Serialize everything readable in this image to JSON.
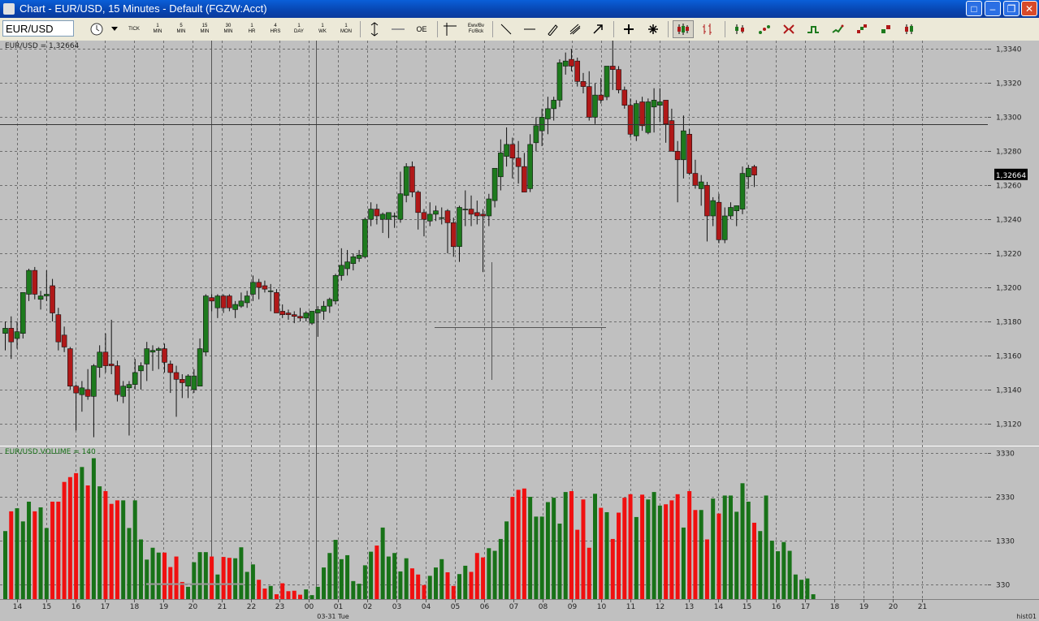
{
  "window": {
    "title": "Chart - EUR/USD,  15 Minutes - Default (FGZW:Acct)",
    "controls": [
      "restore-icon",
      "minimize-icon",
      "maximize-icon",
      "close-icon"
    ]
  },
  "toolbar": {
    "symbol": "EUR/USD",
    "interval_buttons": [
      {
        "top": "",
        "bottom": "TICK"
      },
      {
        "top": "1",
        "bottom": "MIN"
      },
      {
        "top": "5",
        "bottom": "MIN"
      },
      {
        "top": "15",
        "bottom": "MIN"
      },
      {
        "top": "30",
        "bottom": "MIN"
      },
      {
        "top": "1",
        "bottom": "HR"
      },
      {
        "top": "4",
        "bottom": "HRS"
      },
      {
        "top": "1",
        "bottom": "DAY"
      },
      {
        "top": "1",
        "bottom": "WK"
      },
      {
        "top": "1",
        "bottom": "MON"
      }
    ],
    "oe_label": "OE",
    "text_tool": {
      "top": "Ewv/Bv",
      "bottom": "Fc/Bck"
    },
    "icons": [
      "clock-icon",
      "dropdown-icon",
      "autoscale-icon",
      "flat-line-icon",
      "crosshair-icon",
      "line-icon",
      "horizontal-line-icon",
      "pencil-icon",
      "fork-icon",
      "arrow-icon",
      "plus-icon",
      "star-icon",
      "candlestick-icon",
      "bar-chart-icon",
      "ohlc-icon",
      "dots-icon",
      "point-figure-icon",
      "step-line-icon",
      "tick-line-icon",
      "renko-icon",
      "kagi-icon",
      "range-icon"
    ]
  },
  "chart_data": [
    {
      "type": "candlestick",
      "label": "EUR/USD = 1,32664",
      "last_price_tag": "1,32664",
      "ylim": [
        1.3108,
        1.3345
      ],
      "yticks": [
        "1,3120",
        "1,3140",
        "1,3160",
        "1,3180",
        "1,3200",
        "1,3220",
        "1,3240",
        "1,3260",
        "1,3280",
        "1,3300",
        "1,3320",
        "1,3340"
      ],
      "ytick_values": [
        1.312,
        1.314,
        1.316,
        1.318,
        1.32,
        1.322,
        1.324,
        1.326,
        1.328,
        1.33,
        1.332,
        1.334
      ],
      "x_labels": [
        "14",
        "15",
        "16",
        "17",
        "18",
        "19",
        "20",
        "21",
        "22",
        "23",
        "00",
        "01",
        "02",
        "03",
        "04",
        "05",
        "06",
        "07",
        "08",
        "09",
        "10",
        "11",
        "12",
        "13",
        "14",
        "15",
        "16",
        "17",
        "18",
        "19",
        "20",
        "21"
      ],
      "date_label": "03-31 Tue",
      "crosshair_price": 1.3296,
      "grid": true,
      "bull_color": "#1d7a1d",
      "bear_color": "#b01818",
      "candles": [
        [
          1.3173,
          1.318,
          1.3163,
          1.3176
        ],
        [
          1.3176,
          1.3183,
          1.3158,
          1.3168
        ],
        [
          1.317,
          1.318,
          1.3164,
          1.3174
        ],
        [
          1.3173,
          1.3197,
          1.317,
          1.3197
        ],
        [
          1.3196,
          1.3211,
          1.3192,
          1.321
        ],
        [
          1.321,
          1.3212,
          1.3193,
          1.3196
        ],
        [
          1.3193,
          1.3198,
          1.3187,
          1.3195
        ],
        [
          1.3195,
          1.321,
          1.3192,
          1.3196
        ],
        [
          1.3201,
          1.3205,
          1.318,
          1.3185
        ],
        [
          1.3184,
          1.3188,
          1.3163,
          1.3168
        ],
        [
          1.3172,
          1.3177,
          1.3162,
          1.3165
        ],
        [
          1.3164,
          1.3165,
          1.314,
          1.3142
        ],
        [
          1.3142,
          1.3143,
          1.3116,
          1.3138
        ],
        [
          1.3137,
          1.3145,
          1.3127,
          1.3141
        ],
        [
          1.314,
          1.3152,
          1.3134,
          1.3136
        ],
        [
          1.3136,
          1.3155,
          1.3112,
          1.3154
        ],
        [
          1.3153,
          1.3166,
          1.3147,
          1.3162
        ],
        [
          1.3162,
          1.3173,
          1.315,
          1.3154
        ],
        [
          1.3155,
          1.3181,
          1.3149,
          1.3154
        ],
        [
          1.3154,
          1.3157,
          1.3133,
          1.3137
        ],
        [
          1.3136,
          1.3145,
          1.3132,
          1.3142
        ],
        [
          1.3141,
          1.3145,
          1.3113,
          1.3143
        ],
        [
          1.3143,
          1.3158,
          1.314,
          1.315
        ],
        [
          1.3151,
          1.3156,
          1.314,
          1.3154
        ],
        [
          1.3155,
          1.3168,
          1.3145,
          1.3164
        ],
        [
          1.3162,
          1.3166,
          1.3151,
          1.3163
        ],
        [
          1.3163,
          1.3165,
          1.3152,
          1.3164
        ],
        [
          1.3164,
          1.3167,
          1.315,
          1.3156
        ],
        [
          1.3155,
          1.3157,
          1.3138,
          1.315
        ],
        [
          1.315,
          1.3154,
          1.3124,
          1.3146
        ],
        [
          1.3146,
          1.3149,
          1.3135,
          1.3144
        ],
        [
          1.3142,
          1.3149,
          1.3135,
          1.3148
        ],
        [
          1.314,
          1.3152,
          1.3138,
          1.3148
        ],
        [
          1.3142,
          1.317,
          1.3142,
          1.3164
        ],
        [
          1.3162,
          1.3196,
          1.316,
          1.3195
        ],
        [
          1.3194,
          1.3196,
          1.3186,
          1.3192
        ],
        [
          1.3188,
          1.3196,
          1.3182,
          1.3195
        ],
        [
          1.3195,
          1.3196,
          1.3185,
          1.3188
        ],
        [
          1.3195,
          1.3196,
          1.3186,
          1.3188
        ],
        [
          1.3187,
          1.3192,
          1.3182,
          1.319
        ],
        [
          1.3189,
          1.3197,
          1.3188,
          1.3192
        ],
        [
          1.3191,
          1.3198,
          1.3188,
          1.3195
        ],
        [
          1.3196,
          1.3207,
          1.3192,
          1.3203
        ],
        [
          1.3203,
          1.3205,
          1.3193,
          1.32
        ],
        [
          1.3201,
          1.3204,
          1.3197,
          1.3199
        ],
        [
          1.3198,
          1.3202,
          1.3186,
          1.3198
        ],
        [
          1.3197,
          1.3199,
          1.3186,
          1.3185
        ],
        [
          1.3186,
          1.319,
          1.3182,
          1.3184
        ],
        [
          1.3185,
          1.3187,
          1.3181,
          1.3184
        ],
        [
          1.3184,
          1.3186,
          1.3179,
          1.3183
        ],
        [
          1.3183,
          1.3188,
          1.318,
          1.3182
        ],
        [
          1.3182,
          1.3186,
          1.318,
          1.3185
        ],
        [
          1.3179,
          1.3186,
          1.3178,
          1.3186
        ],
        [
          1.3185,
          1.3189,
          1.3171,
          1.3187
        ],
        [
          1.3186,
          1.3192,
          1.3181,
          1.3189
        ],
        [
          1.3189,
          1.3194,
          1.3185,
          1.3193
        ],
        [
          1.3192,
          1.3208,
          1.319,
          1.3207
        ],
        [
          1.3207,
          1.3223,
          1.3204,
          1.3213
        ],
        [
          1.3211,
          1.3222,
          1.3207,
          1.3215
        ],
        [
          1.3214,
          1.322,
          1.321,
          1.3218
        ],
        [
          1.3217,
          1.3222,
          1.3215,
          1.3219
        ],
        [
          1.3218,
          1.3241,
          1.3217,
          1.324
        ],
        [
          1.324,
          1.325,
          1.3236,
          1.3246
        ],
        [
          1.3246,
          1.3249,
          1.3237,
          1.3242
        ],
        [
          1.324,
          1.3244,
          1.3232,
          1.3243
        ],
        [
          1.324,
          1.3243,
          1.3229,
          1.3244
        ],
        [
          1.3242,
          1.3244,
          1.3235,
          1.3242
        ],
        [
          1.324,
          1.3268,
          1.3238,
          1.3255
        ],
        [
          1.3254,
          1.3273,
          1.325,
          1.3271
        ],
        [
          1.3271,
          1.3274,
          1.3253,
          1.3256
        ],
        [
          1.3256,
          1.3257,
          1.3234,
          1.3244
        ],
        [
          1.3244,
          1.3246,
          1.323,
          1.324
        ],
        [
          1.3239,
          1.325,
          1.3236,
          1.3243
        ],
        [
          1.3243,
          1.3248,
          1.3239,
          1.3245
        ],
        [
          1.3241,
          1.3247,
          1.3237,
          1.3241
        ],
        [
          1.3245,
          1.3246,
          1.322,
          1.3238
        ],
        [
          1.3238,
          1.3241,
          1.3218,
          1.3224
        ],
        [
          1.3224,
          1.3248,
          1.3215,
          1.3247
        ],
        [
          1.3246,
          1.3257,
          1.3236,
          1.3246
        ],
        [
          1.3246,
          1.3254,
          1.3236,
          1.3243
        ],
        [
          1.3244,
          1.3251,
          1.3237,
          1.3242
        ],
        [
          1.3243,
          1.3246,
          1.3209,
          1.3242
        ],
        [
          1.3242,
          1.3255,
          1.3236,
          1.3252
        ],
        [
          1.3251,
          1.3269,
          1.3247,
          1.327
        ],
        [
          1.3265,
          1.3287,
          1.3257,
          1.3279
        ],
        [
          1.3277,
          1.3294,
          1.3271,
          1.3284
        ],
        [
          1.3284,
          1.3288,
          1.3264,
          1.3276
        ],
        [
          1.3276,
          1.3286,
          1.3261,
          1.3271
        ],
        [
          1.3271,
          1.3279,
          1.3256,
          1.3256
        ],
        [
          1.3258,
          1.329,
          1.3256,
          1.3284
        ],
        [
          1.3285,
          1.33,
          1.328,
          1.3295
        ],
        [
          1.3292,
          1.3305,
          1.3283,
          1.33
        ],
        [
          1.3299,
          1.3312,
          1.329,
          1.3305
        ],
        [
          1.3305,
          1.3312,
          1.3298,
          1.331
        ],
        [
          1.331,
          1.3334,
          1.3306,
          1.3332
        ],
        [
          1.333,
          1.3338,
          1.3325,
          1.3333
        ],
        [
          1.3334,
          1.334,
          1.3327,
          1.333
        ],
        [
          1.3333,
          1.3335,
          1.3318,
          1.3321
        ],
        [
          1.3321,
          1.3326,
          1.3314,
          1.3318
        ],
        [
          1.3318,
          1.3327,
          1.3298,
          1.33
        ],
        [
          1.33,
          1.332,
          1.3296,
          1.3313
        ],
        [
          1.3313,
          1.3323,
          1.3308,
          1.331
        ],
        [
          1.3312,
          1.333,
          1.331,
          1.333
        ],
        [
          1.333,
          1.3345,
          1.3316,
          1.3328
        ],
        [
          1.3328,
          1.333,
          1.3314,
          1.3316
        ],
        [
          1.3316,
          1.3318,
          1.3305,
          1.3307
        ],
        [
          1.3307,
          1.3311,
          1.3288,
          1.329
        ],
        [
          1.3289,
          1.331,
          1.3286,
          1.3308
        ],
        [
          1.3309,
          1.3312,
          1.3292,
          1.3295
        ],
        [
          1.3291,
          1.3311,
          1.329,
          1.3309
        ],
        [
          1.3306,
          1.3317,
          1.3291,
          1.331
        ],
        [
          1.3307,
          1.3317,
          1.3297,
          1.3309
        ],
        [
          1.331,
          1.331,
          1.3285,
          1.3296
        ],
        [
          1.3298,
          1.3305,
          1.328,
          1.328
        ],
        [
          1.328,
          1.3286,
          1.325,
          1.3275
        ],
        [
          1.3275,
          1.3301,
          1.3264,
          1.3292
        ],
        [
          1.329,
          1.3293,
          1.3266,
          1.3267
        ],
        [
          1.3267,
          1.3275,
          1.3258,
          1.326
        ],
        [
          1.3258,
          1.3266,
          1.3248,
          1.3262
        ],
        [
          1.326,
          1.3262,
          1.3227,
          1.3242
        ],
        [
          1.3242,
          1.3253,
          1.3236,
          1.3251
        ],
        [
          1.325,
          1.3255,
          1.3226,
          1.3228
        ],
        [
          1.3228,
          1.3247,
          1.3226,
          1.3242
        ],
        [
          1.3242,
          1.325,
          1.324,
          1.3247
        ],
        [
          1.3245,
          1.3248,
          1.3236,
          1.3248
        ],
        [
          1.3246,
          1.3271,
          1.3243,
          1.3267
        ],
        [
          1.3265,
          1.3272,
          1.3258,
          1.327
        ],
        [
          1.3271,
          1.3272,
          1.3259,
          1.3266
        ]
      ]
    },
    {
      "type": "bar",
      "label": "EUR/USD.VOLUME = 140",
      "ylim": [
        0,
        3330
      ],
      "yticks": [
        "330",
        "1330",
        "2330",
        "3330"
      ],
      "ytick_values": [
        330,
        1330,
        2330,
        3330
      ],
      "grid": true,
      "bull_color": "#187218",
      "bear_color": "#f01010",
      "values": [
        1550,
        2000,
        2070,
        1770,
        2220,
        2000,
        2090,
        1620,
        2220,
        2220,
        2670,
        2780,
        2870,
        3010,
        2590,
        3210,
        2570,
        2460,
        2170,
        2250,
        2250,
        1620,
        2250,
        1360,
        900,
        1170,
        1060,
        1060,
        730,
        970,
        390,
        280,
        840,
        1070,
        1070,
        970,
        560,
        960,
        940,
        930,
        1180,
        620,
        790,
        440,
        240,
        300,
        110,
        360,
        180,
        190,
        100,
        220,
        90,
        280,
        720,
        1050,
        1350,
        910,
        1000,
        410,
        350,
        770,
        1080,
        1220,
        1630,
        970,
        1050,
        630,
        930,
        700,
        560,
        320,
        530,
        720,
        910,
        610,
        300,
        570,
        760,
        620,
        1050,
        950,
        1160,
        1100,
        1370,
        1770,
        2330,
        2490,
        2520,
        2330,
        1880,
        1880,
        2210,
        2310,
        1720,
        2440,
        2460,
        1580,
        2270,
        1170,
        2400,
        2080,
        1980,
        1370,
        1970,
        2310,
        2390,
        1870,
        2380,
        2270,
        2440,
        2130,
        2160,
        2250,
        2390,
        1630,
        2460,
        2030,
        2030,
        1360,
        2290,
        1950,
        2360,
        2360,
        1990,
        2640,
        2220,
        1740,
        1550,
        2360,
        1330,
        1090,
        1300,
        1100,
        560,
        440,
        470,
        110
      ]
    }
  ],
  "corner_label": "hist01"
}
